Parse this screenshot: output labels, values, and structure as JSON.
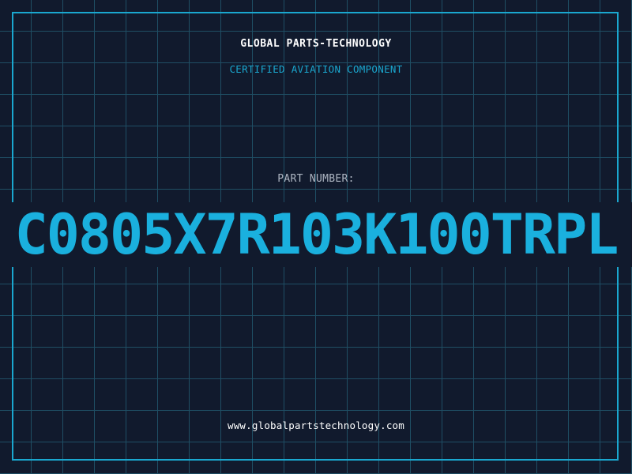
{
  "header": {
    "company_name": "GLOBAL PARTS-TECHNOLOGY",
    "subtitle": "CERTIFIED AVIATION COMPONENT"
  },
  "part": {
    "label": "PART NUMBER:",
    "number": "C0805X7R103K100TRPL"
  },
  "footer": {
    "website": "www.globalpartstechnology.com"
  },
  "colors": {
    "background": "#111a2d",
    "grid": "#1f4e64",
    "accent": "#1aa7cf",
    "part_number": "#1ab0de",
    "heading_text": "#ffffff",
    "label_text": "#aeb6c2"
  }
}
